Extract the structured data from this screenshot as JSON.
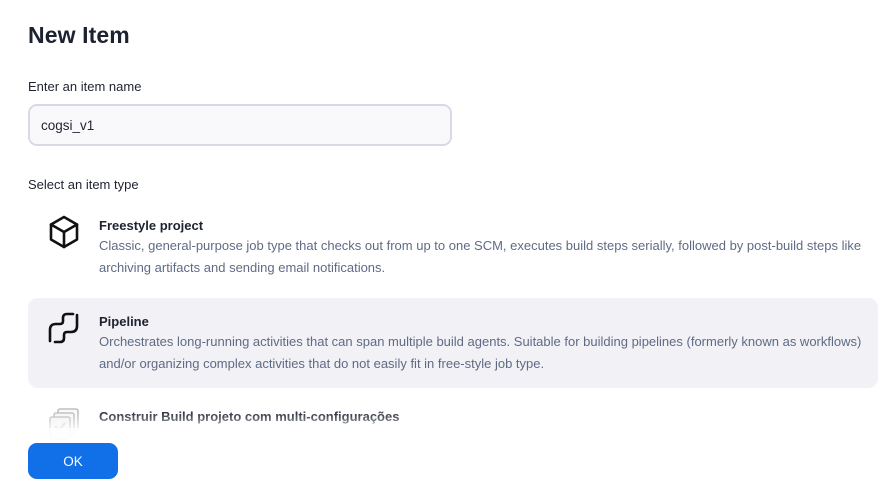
{
  "page": {
    "title": "New Item",
    "name_label": "Enter an item name",
    "type_label": "Select an item type"
  },
  "item_name": {
    "value": "cogsi_v1"
  },
  "item_types": [
    {
      "name": "Freestyle project",
      "description": "Classic, general-purpose job type that checks out from up to one SCM, executes build steps serially, followed by post-build steps like archiving artifacts and sending email notifications.",
      "icon": "cube-icon",
      "selected": false
    },
    {
      "name": "Pipeline",
      "description": "Orchestrates long-running activities that can span multiple build agents. Suitable for building pipelines (formerly known as workflows) and/or organizing complex activities that do not easily fit in free-style job type.",
      "icon": "pipeline-icon",
      "selected": true
    },
    {
      "name": "Construir Build projeto com multi-configurações",
      "description": "",
      "icon": "multi-configuration-icon",
      "selected": false
    }
  ],
  "footer": {
    "ok_label": "OK"
  },
  "colors": {
    "accent": "#1170e8",
    "selected_background": "#f1f1f6",
    "description_text": "#5f6b85"
  }
}
